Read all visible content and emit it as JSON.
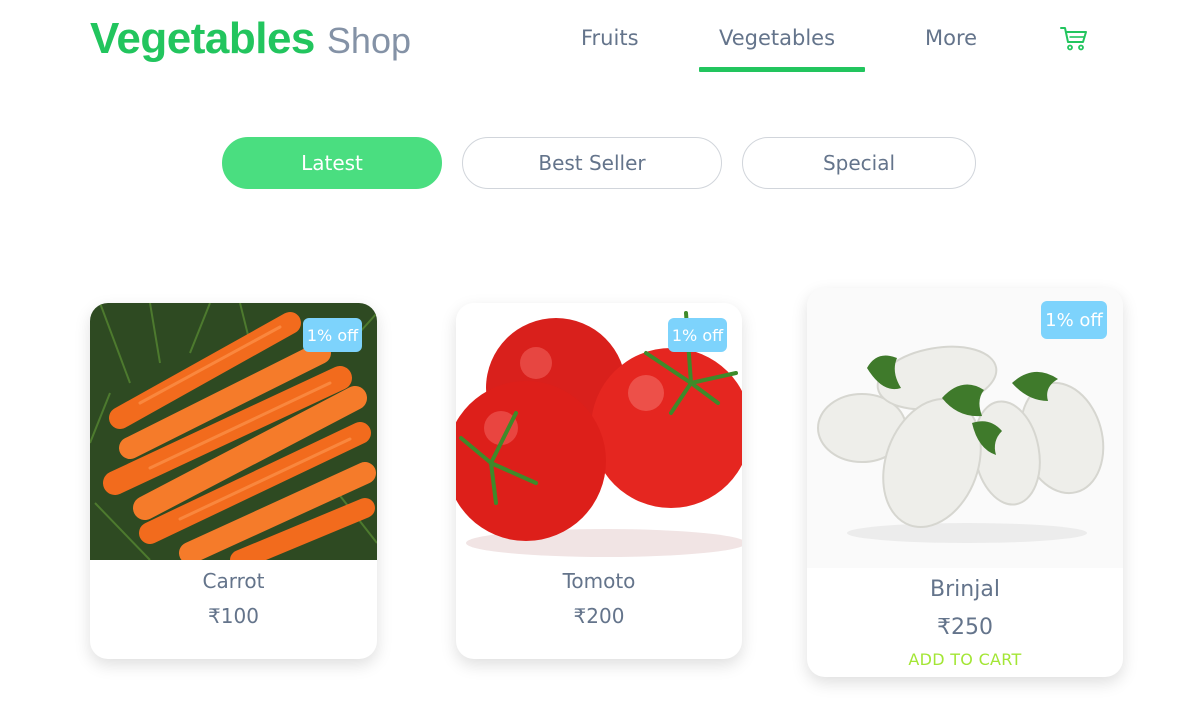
{
  "brand": {
    "strong": "Vegetables",
    "light": "Shop"
  },
  "nav": {
    "items": [
      {
        "label": "Fruits"
      },
      {
        "label": "Vegetables"
      },
      {
        "label": "More"
      }
    ],
    "active": "Vegetables",
    "cart_icon": "cart-icon"
  },
  "filters": {
    "items": [
      {
        "label": "Latest"
      },
      {
        "label": "Best Seller"
      },
      {
        "label": "Special"
      }
    ],
    "active": "Latest"
  },
  "products": [
    {
      "name": "Carrot",
      "price": "₹100",
      "badge": "1% off",
      "image": "carrot-image"
    },
    {
      "name": "Tomoto",
      "price": "₹200",
      "badge": "1% off",
      "image": "tomato-image"
    },
    {
      "name": "Brinjal",
      "price": "₹250",
      "badge": "1% off",
      "image": "brinjal-image",
      "action": "ADD TO CART"
    }
  ],
  "colors": {
    "brand_green": "#22c55e",
    "pill_green": "#4ade80",
    "badge_blue": "#7dd3fc",
    "add_cart": "#a3e635",
    "text": "#64748b"
  }
}
